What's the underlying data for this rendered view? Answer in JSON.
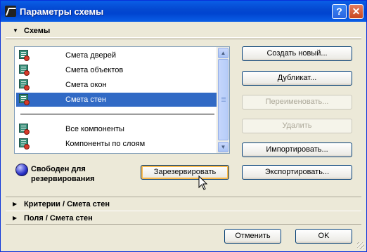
{
  "window": {
    "title": "Параметры схемы",
    "help": "?",
    "close": "✕"
  },
  "sections": {
    "schemes": {
      "label": "Схемы",
      "arrow": "▼"
    },
    "criteria": {
      "label": "Критерии /  Смета стен",
      "arrow": "▶"
    },
    "fields": {
      "label": "Поля /  Смета стен",
      "arrow": "▶"
    }
  },
  "list": {
    "items": [
      {
        "label": "Смета дверей",
        "selected": false
      },
      {
        "label": "Смета объектов",
        "selected": false
      },
      {
        "label": "Смета окон",
        "selected": false
      },
      {
        "label": "Смета стен",
        "selected": true
      },
      {
        "label": "Все компоненты",
        "selected": false
      },
      {
        "label": "Компоненты по слоям",
        "selected": false
      }
    ]
  },
  "buttons": {
    "create": "Создать новый...",
    "duplicate": "Дубликат...",
    "rename": "Переименовать...",
    "delete": "Удалить",
    "import": "Импортировать...",
    "export": "Экспортировать...",
    "reserve": "Зарезервировать",
    "cancel": "Отменить",
    "ok": "OK"
  },
  "status": {
    "text": "Свободен для резервирования",
    "color": "#2a32c8"
  },
  "icons": {
    "list_item": "schedule-icon",
    "status": "reservation-status-icon",
    "scroll_up": "▲",
    "scroll_down": "▼"
  }
}
